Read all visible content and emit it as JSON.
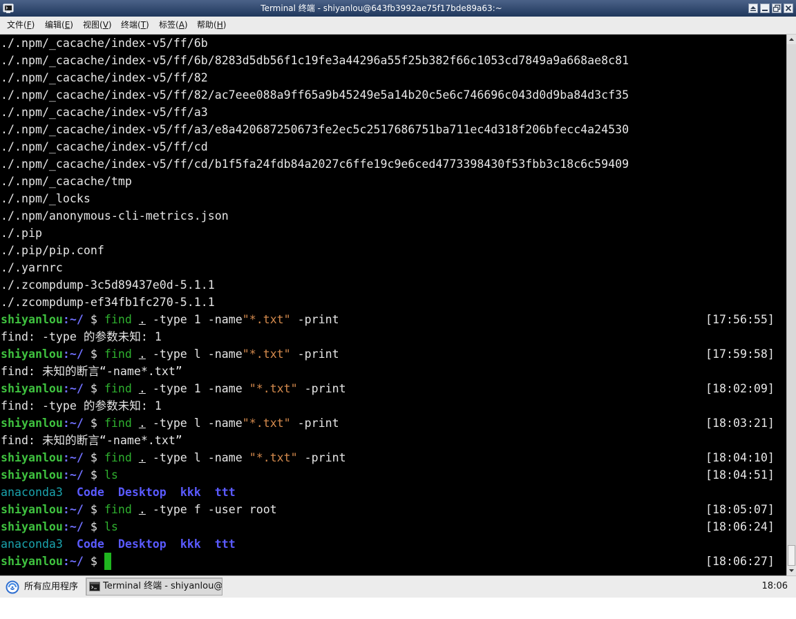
{
  "palette": {
    "title_top": "#4b6288",
    "title_bottom": "#1f375c",
    "fg": "#e6e6e6",
    "user": "#3fc23f",
    "cwd": "#7070ff",
    "cmd": "#2fb12f",
    "string": "#d48a4d",
    "dir": "#5a5aff",
    "link": "#1aa3ad",
    "cursor": "#1fb51f"
  },
  "window": {
    "title": "Terminal 终端 - shiyanlou@643fb3992ae75f17bde89a63:~",
    "app_icon": "terminal-app-icon",
    "controls": [
      "shade-icon",
      "minimize-icon",
      "maximize-icon",
      "close-icon"
    ]
  },
  "menu": [
    {
      "label": "文件(F)"
    },
    {
      "label": "编辑(E)"
    },
    {
      "label": "视图(V)"
    },
    {
      "label": "终端(T)"
    },
    {
      "label": "标签(A)"
    },
    {
      "label": "帮助(H)"
    }
  ],
  "terminal": {
    "scrollbar": {
      "position": 1.0,
      "visible_fraction": 0.04
    },
    "lines": [
      {
        "segments": [
          {
            "kind": "text",
            "t": "./.npm/_cacache/index-v5/ff/6b"
          }
        ]
      },
      {
        "segments": [
          {
            "kind": "text",
            "t": "./.npm/_cacache/index-v5/ff/6b/8283d5db56f1c19fe3a44296a55f25b382f66c1053cd7849a9a668ae8c81"
          }
        ]
      },
      {
        "segments": [
          {
            "kind": "text",
            "t": "./.npm/_cacache/index-v5/ff/82"
          }
        ]
      },
      {
        "segments": [
          {
            "kind": "text",
            "t": "./.npm/_cacache/index-v5/ff/82/ac7eee088a9ff65a9b45249e5a14b20c5e6c746696c043d0d9ba84d3cf35"
          }
        ]
      },
      {
        "segments": [
          {
            "kind": "text",
            "t": "./.npm/_cacache/index-v5/ff/a3"
          }
        ]
      },
      {
        "segments": [
          {
            "kind": "text",
            "t": "./.npm/_cacache/index-v5/ff/a3/e8a420687250673fe2ec5c2517686751ba711ec4d318f206bfecc4a24530"
          }
        ]
      },
      {
        "segments": [
          {
            "kind": "text",
            "t": "./.npm/_cacache/index-v5/ff/cd"
          }
        ]
      },
      {
        "segments": [
          {
            "kind": "text",
            "t": "./.npm/_cacache/index-v5/ff/cd/b1f5fa24fdb84a2027c6ffe19c9e6ced4773398430f53fbb3c18c6c59409"
          }
        ]
      },
      {
        "segments": [
          {
            "kind": "text",
            "t": "./.npm/_cacache/tmp"
          }
        ]
      },
      {
        "segments": [
          {
            "kind": "text",
            "t": "./.npm/_locks"
          }
        ]
      },
      {
        "segments": [
          {
            "kind": "text",
            "t": "./.npm/anonymous-cli-metrics.json"
          }
        ]
      },
      {
        "segments": [
          {
            "kind": "text",
            "t": "./.pip"
          }
        ]
      },
      {
        "segments": [
          {
            "kind": "text",
            "t": "./.pip/pip.conf"
          }
        ]
      },
      {
        "segments": [
          {
            "kind": "text",
            "t": "./.yarnrc"
          }
        ]
      },
      {
        "segments": [
          {
            "kind": "text",
            "t": "./.zcompdump-3c5d89437e0d-5.1.1"
          }
        ]
      },
      {
        "segments": [
          {
            "kind": "text",
            "t": "./.zcompdump-ef34fb1fc270-5.1.1"
          }
        ]
      },
      {
        "segments": [
          {
            "kind": "user",
            "t": "shiyanlou"
          },
          {
            "kind": "cwd",
            "t": ":~/"
          },
          {
            "kind": "symbol",
            "t": " $ "
          },
          {
            "kind": "cmd",
            "t": "find"
          },
          {
            "kind": "text",
            "t": " "
          },
          {
            "kind": "path-arg",
            "t": "."
          },
          {
            "kind": "text",
            "t": " -type 1 -name"
          },
          {
            "kind": "string",
            "t": "\"*.txt\""
          },
          {
            "kind": "text",
            "t": " -print"
          }
        ],
        "time": "[17:56:55]"
      },
      {
        "segments": [
          {
            "kind": "text",
            "t": "find: -type 的参数未知: 1"
          }
        ]
      },
      {
        "segments": [
          {
            "kind": "user",
            "t": "shiyanlou"
          },
          {
            "kind": "cwd",
            "t": ":~/"
          },
          {
            "kind": "symbol",
            "t": " $ "
          },
          {
            "kind": "cmd",
            "t": "find"
          },
          {
            "kind": "text",
            "t": " "
          },
          {
            "kind": "path-arg",
            "t": "."
          },
          {
            "kind": "text",
            "t": " -type l -name"
          },
          {
            "kind": "string",
            "t": "\"*.txt\""
          },
          {
            "kind": "text",
            "t": " -print"
          }
        ],
        "time": "[17:59:58]"
      },
      {
        "segments": [
          {
            "kind": "text",
            "t": "find: 未知的断言“-name*.txt”"
          }
        ]
      },
      {
        "segments": [
          {
            "kind": "user",
            "t": "shiyanlou"
          },
          {
            "kind": "cwd",
            "t": ":~/"
          },
          {
            "kind": "symbol",
            "t": " $ "
          },
          {
            "kind": "cmd",
            "t": "find"
          },
          {
            "kind": "text",
            "t": " "
          },
          {
            "kind": "path-arg",
            "t": "."
          },
          {
            "kind": "text",
            "t": " -type 1 -name "
          },
          {
            "kind": "string",
            "t": "\"*.txt\""
          },
          {
            "kind": "text",
            "t": " -print"
          }
        ],
        "time": "[18:02:09]"
      },
      {
        "segments": [
          {
            "kind": "text",
            "t": "find: -type 的参数未知: 1"
          }
        ]
      },
      {
        "segments": [
          {
            "kind": "user",
            "t": "shiyanlou"
          },
          {
            "kind": "cwd",
            "t": ":~/"
          },
          {
            "kind": "symbol",
            "t": " $ "
          },
          {
            "kind": "cmd",
            "t": "find"
          },
          {
            "kind": "text",
            "t": " "
          },
          {
            "kind": "path-arg",
            "t": "."
          },
          {
            "kind": "text",
            "t": " -type l -name"
          },
          {
            "kind": "string",
            "t": "\"*.txt\""
          },
          {
            "kind": "text",
            "t": " -print"
          }
        ],
        "time": "[18:03:21]"
      },
      {
        "segments": [
          {
            "kind": "text",
            "t": "find: 未知的断言“-name*.txt”"
          }
        ]
      },
      {
        "segments": [
          {
            "kind": "user",
            "t": "shiyanlou"
          },
          {
            "kind": "cwd",
            "t": ":~/"
          },
          {
            "kind": "symbol",
            "t": " $ "
          },
          {
            "kind": "cmd",
            "t": "find"
          },
          {
            "kind": "text",
            "t": " "
          },
          {
            "kind": "path-arg",
            "t": "."
          },
          {
            "kind": "text",
            "t": " -type l -name "
          },
          {
            "kind": "string",
            "t": "\"*.txt\""
          },
          {
            "kind": "text",
            "t": " -print"
          }
        ],
        "time": "[18:04:10]"
      },
      {
        "segments": [
          {
            "kind": "user",
            "t": "shiyanlou"
          },
          {
            "kind": "cwd",
            "t": ":~/"
          },
          {
            "kind": "symbol",
            "t": " $ "
          },
          {
            "kind": "cmd",
            "t": "ls"
          }
        ],
        "time": "[18:04:51]"
      },
      {
        "segments": [
          {
            "kind": "link",
            "t": "anaconda3"
          },
          {
            "kind": "text",
            "t": "  "
          },
          {
            "kind": "dir",
            "t": "Code"
          },
          {
            "kind": "text",
            "t": "  "
          },
          {
            "kind": "dir",
            "t": "Desktop"
          },
          {
            "kind": "text",
            "t": "  "
          },
          {
            "kind": "dir",
            "t": "kkk"
          },
          {
            "kind": "text",
            "t": "  "
          },
          {
            "kind": "dir",
            "t": "ttt"
          }
        ]
      },
      {
        "segments": [
          {
            "kind": "user",
            "t": "shiyanlou"
          },
          {
            "kind": "cwd",
            "t": ":~/"
          },
          {
            "kind": "symbol",
            "t": " $ "
          },
          {
            "kind": "cmd",
            "t": "find"
          },
          {
            "kind": "text",
            "t": " "
          },
          {
            "kind": "path-arg",
            "t": "."
          },
          {
            "kind": "text",
            "t": " -type f -user root"
          }
        ],
        "time": "[18:05:07]"
      },
      {
        "segments": [
          {
            "kind": "user",
            "t": "shiyanlou"
          },
          {
            "kind": "cwd",
            "t": ":~/"
          },
          {
            "kind": "symbol",
            "t": " $ "
          },
          {
            "kind": "cmd",
            "t": "ls"
          }
        ],
        "time": "[18:06:24]"
      },
      {
        "segments": [
          {
            "kind": "link",
            "t": "anaconda3"
          },
          {
            "kind": "text",
            "t": "  "
          },
          {
            "kind": "dir",
            "t": "Code"
          },
          {
            "kind": "text",
            "t": "  "
          },
          {
            "kind": "dir",
            "t": "Desktop"
          },
          {
            "kind": "text",
            "t": "  "
          },
          {
            "kind": "dir",
            "t": "kkk"
          },
          {
            "kind": "text",
            "t": "  "
          },
          {
            "kind": "dir",
            "t": "ttt"
          }
        ]
      },
      {
        "segments": [
          {
            "kind": "user",
            "t": "shiyanlou"
          },
          {
            "kind": "cwd",
            "t": ":~/"
          },
          {
            "kind": "symbol",
            "t": " $ "
          },
          {
            "kind": "cursor",
            "t": " "
          }
        ],
        "time": "[18:06:27]"
      }
    ]
  },
  "taskbar": {
    "start_label": "所有应用程序",
    "start_icon": "app-menu-icon",
    "window_button_label": "Terminal 终端 - shiyanlou@…",
    "window_button_icon": "terminal-icon",
    "clock": "18:06"
  }
}
